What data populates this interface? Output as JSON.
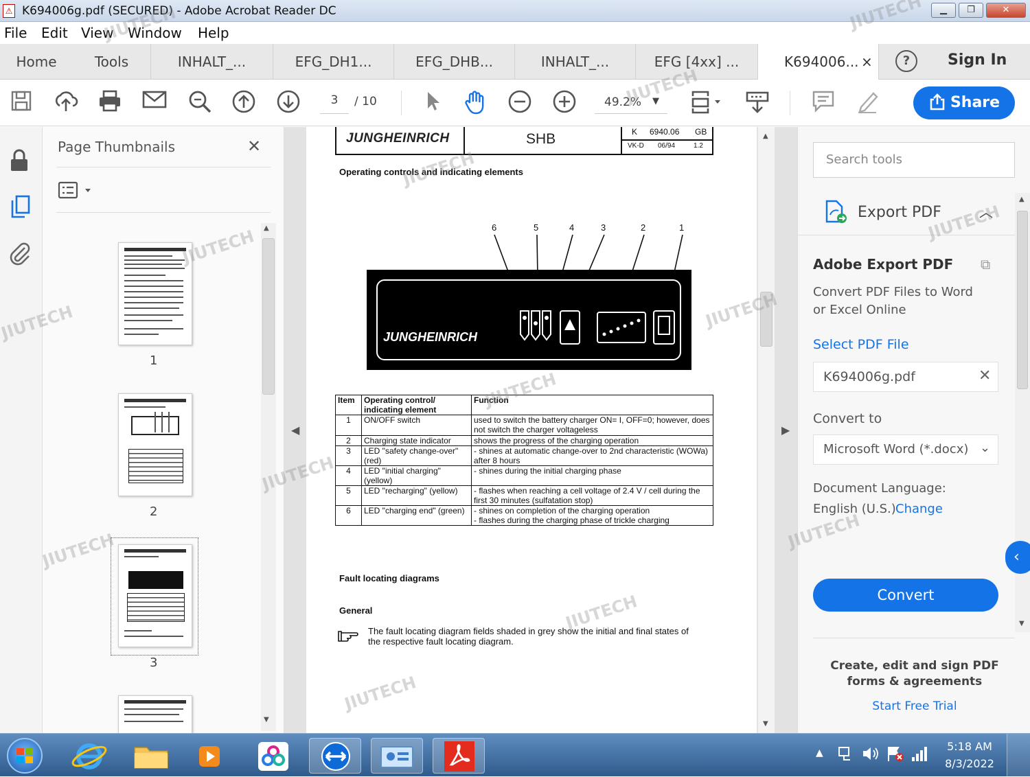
{
  "window": {
    "title": "K694006g.pdf (SECURED) - Adobe Acrobat Reader DC",
    "icon": "pdf-icon",
    "controls": [
      "minimize-icon",
      "restore-icon",
      "close-icon"
    ]
  },
  "menu": [
    "File",
    "Edit",
    "View",
    "Window",
    "Help"
  ],
  "tabs": {
    "home": "Home",
    "tools": "Tools",
    "docs": [
      "INHALT_...",
      "EFG_DH1...",
      "EFG_DHB...",
      "INHALT_...",
      "EFG [4xx] ...",
      "K694006..."
    ],
    "close_glyph": "×",
    "help_icon": "help-icon",
    "sign_in": "Sign In"
  },
  "toolbar": {
    "page_current": "3",
    "page_total": "/ 10",
    "zoom": "49.2%",
    "share": "Share",
    "icons": [
      "save-icon",
      "upload-icon",
      "print-icon",
      "email-icon",
      "zoom-search-icon",
      "page-up-icon",
      "page-down-icon",
      "select-arrow-icon",
      "hand-icon",
      "zoom-out-icon",
      "zoom-in-icon",
      "fit-page-icon",
      "scroll-mode-icon",
      "comment-icon",
      "sign-pen-icon",
      "share-icon"
    ]
  },
  "leftrail": {
    "icons": [
      "lock-icon",
      "pages-icon",
      "attachment-icon"
    ]
  },
  "thumbnails": {
    "title": "Page Thumbnails",
    "close_glyph": "✕",
    "options_icon": "thumbnail-options-icon",
    "pages": [
      "1",
      "2",
      "3"
    ]
  },
  "document": {
    "header": {
      "brand": "JUNGHEINRICH",
      "code": "SHB",
      "doc_no": "K",
      "doc_no2": "6940.06",
      "lang": "GB",
      "row2a": "VK-D",
      "row2b": "06/94",
      "row2c": "1.2"
    },
    "section_title": "Operating controls and indicating elements",
    "callouts": [
      "6",
      "5",
      "4",
      "3",
      "2",
      "1"
    ],
    "panel_brand": "JUNGHEINRICH",
    "table": {
      "headers": [
        "Item",
        "Operating control/ indicating element",
        "Function"
      ],
      "rows": [
        [
          "1",
          "ON/OFF switch",
          "used to switch the battery charger  ON= I, OFF=0; however, does not switch the charger voltageless"
        ],
        [
          "2",
          "Charging state indicator",
          "shows the progress of the charging operation"
        ],
        [
          "3",
          "LED \"safety change-over\" (red)",
          "- shines at automatic change-over to 2nd characteristic (WOWa) after 8 hours"
        ],
        [
          "4",
          "LED \"initial charging\" (yellow)",
          "- shines during the initial charging phase"
        ],
        [
          "5",
          "LED \"recharging\" (yellow)",
          "- flashes when reaching a cell voltage of 2.4 V / cell during the first 30 minutes (sulfatation stop)"
        ],
        [
          "6",
          "LED \"charging end\" (green)",
          "- shines on completion of the charging operation\n- flashes during the charging phase of trickle charging"
        ]
      ]
    },
    "fault_title": "Fault locating diagrams",
    "general_title": "General",
    "note_icon": "pointing-hand-icon",
    "general_text": "The fault locating diagram fields shaded in grey show the initial and final states of the respective fault locating diagram."
  },
  "tools_pane": {
    "search_placeholder": "Search tools",
    "export_title": "Export PDF",
    "adobe_export": "Adobe Export PDF",
    "desc": "Convert PDF Files to Word or Excel Online",
    "select_file": "Select PDF File",
    "file_name": "K694006g.pdf",
    "convert_to_label": "Convert to",
    "format": "Microsoft Word (*.docx)",
    "doc_lang_label": "Document Language:",
    "doc_lang": "English (U.S.)",
    "change": "Change",
    "convert": "Convert",
    "promo": "Create, edit and sign PDF forms & agreements",
    "trial": "Start Free Trial"
  },
  "taskbar": {
    "time": "5:18 AM",
    "date": "8/3/2022",
    "apps": [
      "windows-start-icon",
      "internet-explorer-icon",
      "file-explorer-icon",
      "media-player-icon",
      "photos-app-icon",
      "teamviewer-icon",
      "remote-desktop-icon",
      "acrobat-icon"
    ],
    "tray": [
      "tray-expand-icon",
      "network-icon",
      "volume-icon",
      "flag-icon",
      "signal-icon"
    ]
  },
  "watermark": "JIUTECH",
  "colors": {
    "accent": "#1473e6",
    "panel": "#000000"
  }
}
